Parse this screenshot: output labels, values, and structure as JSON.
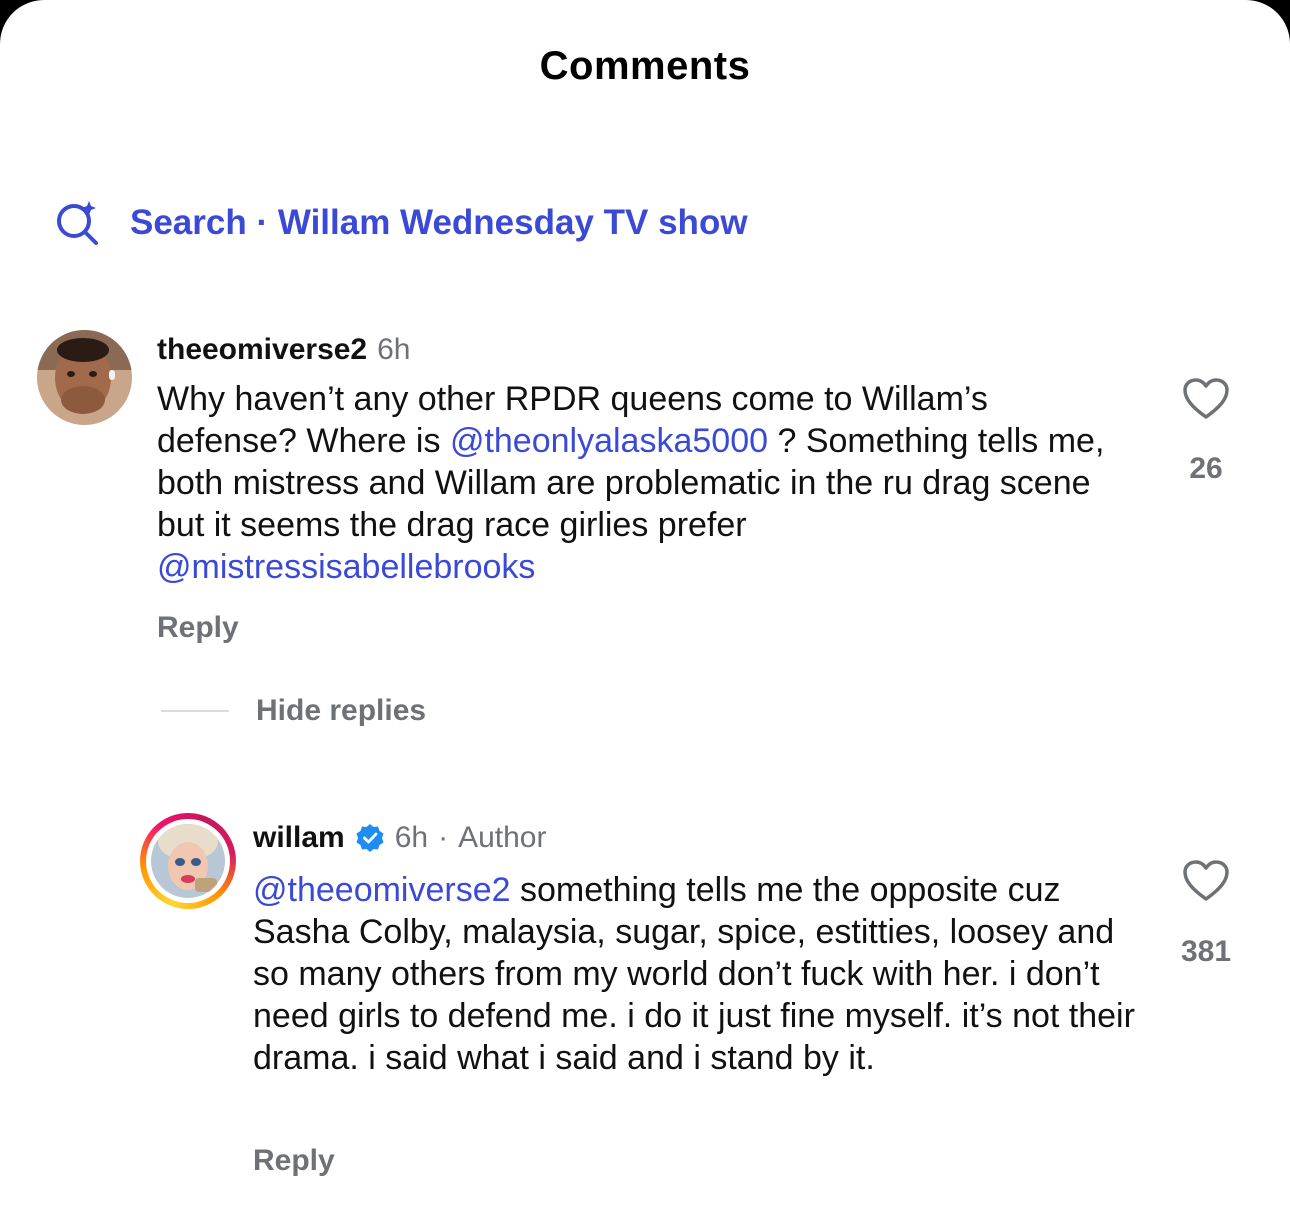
{
  "header": {
    "title": "Comments"
  },
  "search": {
    "text": "Search · Willam Wednesday TV show",
    "icon": "sparkle-search-icon",
    "color": "#3b4ad6"
  },
  "comments": [
    {
      "username": "theeomiverse2",
      "time": "6h",
      "body": [
        {
          "t": "Why haven’t any other RPDR queens come to Willam’s defense? Where is "
        },
        {
          "t": "@theonlyalaska5000",
          "mention": true
        },
        {
          "t": " ? Something tells me, both mistress and Willam are problematic in the ru drag scene but it seems the drag race girlies prefer "
        },
        {
          "t": "@mistressisabellebrooks",
          "mention": true
        }
      ],
      "likes": "26",
      "reply_label": "Reply"
    }
  ],
  "hide_replies_label": "Hide replies",
  "replies": [
    {
      "username": "willam",
      "verified": true,
      "time": "6h",
      "separator": "·",
      "author_label": "Author",
      "body": [
        {
          "t": "@theeomiverse2",
          "mention": true
        },
        {
          "t": " something tells me the opposite cuz Sasha Colby,  malaysia, sugar, spice, estitties, loosey and so many others from my world don’t fuck with her. i don’t need girls to defend me. i do it just fine myself. it’s not their drama. i said what i said and i stand by it."
        }
      ],
      "likes": "381",
      "reply_label": "Reply"
    }
  ]
}
